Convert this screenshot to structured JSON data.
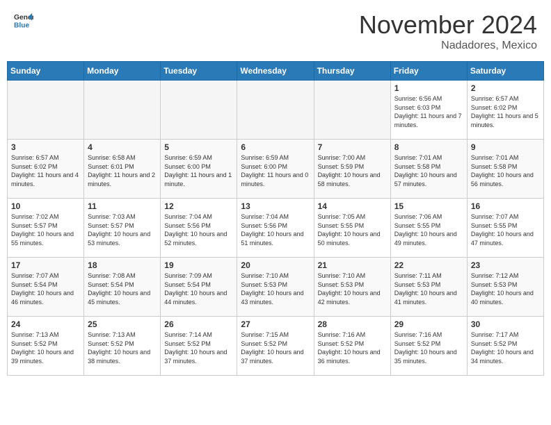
{
  "header": {
    "logo_general": "General",
    "logo_blue": "Blue",
    "month_title": "November 2024",
    "location": "Nadadores, Mexico"
  },
  "days_of_week": [
    "Sunday",
    "Monday",
    "Tuesday",
    "Wednesday",
    "Thursday",
    "Friday",
    "Saturday"
  ],
  "weeks": [
    [
      {
        "day": "",
        "empty": true
      },
      {
        "day": "",
        "empty": true
      },
      {
        "day": "",
        "empty": true
      },
      {
        "day": "",
        "empty": true
      },
      {
        "day": "",
        "empty": true
      },
      {
        "day": "1",
        "sunrise": "6:56 AM",
        "sunset": "6:03 PM",
        "daylight": "11 hours and 7 minutes."
      },
      {
        "day": "2",
        "sunrise": "6:57 AM",
        "sunset": "6:02 PM",
        "daylight": "11 hours and 5 minutes."
      }
    ],
    [
      {
        "day": "3",
        "sunrise": "6:57 AM",
        "sunset": "6:02 PM",
        "daylight": "11 hours and 4 minutes."
      },
      {
        "day": "4",
        "sunrise": "6:58 AM",
        "sunset": "6:01 PM",
        "daylight": "11 hours and 2 minutes."
      },
      {
        "day": "5",
        "sunrise": "6:59 AM",
        "sunset": "6:00 PM",
        "daylight": "11 hours and 1 minute."
      },
      {
        "day": "6",
        "sunrise": "6:59 AM",
        "sunset": "6:00 PM",
        "daylight": "11 hours and 0 minutes."
      },
      {
        "day": "7",
        "sunrise": "7:00 AM",
        "sunset": "5:59 PM",
        "daylight": "10 hours and 58 minutes."
      },
      {
        "day": "8",
        "sunrise": "7:01 AM",
        "sunset": "5:58 PM",
        "daylight": "10 hours and 57 minutes."
      },
      {
        "day": "9",
        "sunrise": "7:01 AM",
        "sunset": "5:58 PM",
        "daylight": "10 hours and 56 minutes."
      }
    ],
    [
      {
        "day": "10",
        "sunrise": "7:02 AM",
        "sunset": "5:57 PM",
        "daylight": "10 hours and 55 minutes."
      },
      {
        "day": "11",
        "sunrise": "7:03 AM",
        "sunset": "5:57 PM",
        "daylight": "10 hours and 53 minutes."
      },
      {
        "day": "12",
        "sunrise": "7:04 AM",
        "sunset": "5:56 PM",
        "daylight": "10 hours and 52 minutes."
      },
      {
        "day": "13",
        "sunrise": "7:04 AM",
        "sunset": "5:56 PM",
        "daylight": "10 hours and 51 minutes."
      },
      {
        "day": "14",
        "sunrise": "7:05 AM",
        "sunset": "5:55 PM",
        "daylight": "10 hours and 50 minutes."
      },
      {
        "day": "15",
        "sunrise": "7:06 AM",
        "sunset": "5:55 PM",
        "daylight": "10 hours and 49 minutes."
      },
      {
        "day": "16",
        "sunrise": "7:07 AM",
        "sunset": "5:55 PM",
        "daylight": "10 hours and 47 minutes."
      }
    ],
    [
      {
        "day": "17",
        "sunrise": "7:07 AM",
        "sunset": "5:54 PM",
        "daylight": "10 hours and 46 minutes."
      },
      {
        "day": "18",
        "sunrise": "7:08 AM",
        "sunset": "5:54 PM",
        "daylight": "10 hours and 45 minutes."
      },
      {
        "day": "19",
        "sunrise": "7:09 AM",
        "sunset": "5:54 PM",
        "daylight": "10 hours and 44 minutes."
      },
      {
        "day": "20",
        "sunrise": "7:10 AM",
        "sunset": "5:53 PM",
        "daylight": "10 hours and 43 minutes."
      },
      {
        "day": "21",
        "sunrise": "7:10 AM",
        "sunset": "5:53 PM",
        "daylight": "10 hours and 42 minutes."
      },
      {
        "day": "22",
        "sunrise": "7:11 AM",
        "sunset": "5:53 PM",
        "daylight": "10 hours and 41 minutes."
      },
      {
        "day": "23",
        "sunrise": "7:12 AM",
        "sunset": "5:53 PM",
        "daylight": "10 hours and 40 minutes."
      }
    ],
    [
      {
        "day": "24",
        "sunrise": "7:13 AM",
        "sunset": "5:52 PM",
        "daylight": "10 hours and 39 minutes."
      },
      {
        "day": "25",
        "sunrise": "7:13 AM",
        "sunset": "5:52 PM",
        "daylight": "10 hours and 38 minutes."
      },
      {
        "day": "26",
        "sunrise": "7:14 AM",
        "sunset": "5:52 PM",
        "daylight": "10 hours and 37 minutes."
      },
      {
        "day": "27",
        "sunrise": "7:15 AM",
        "sunset": "5:52 PM",
        "daylight": "10 hours and 37 minutes."
      },
      {
        "day": "28",
        "sunrise": "7:16 AM",
        "sunset": "5:52 PM",
        "daylight": "10 hours and 36 minutes."
      },
      {
        "day": "29",
        "sunrise": "7:16 AM",
        "sunset": "5:52 PM",
        "daylight": "10 hours and 35 minutes."
      },
      {
        "day": "30",
        "sunrise": "7:17 AM",
        "sunset": "5:52 PM",
        "daylight": "10 hours and 34 minutes."
      }
    ]
  ]
}
